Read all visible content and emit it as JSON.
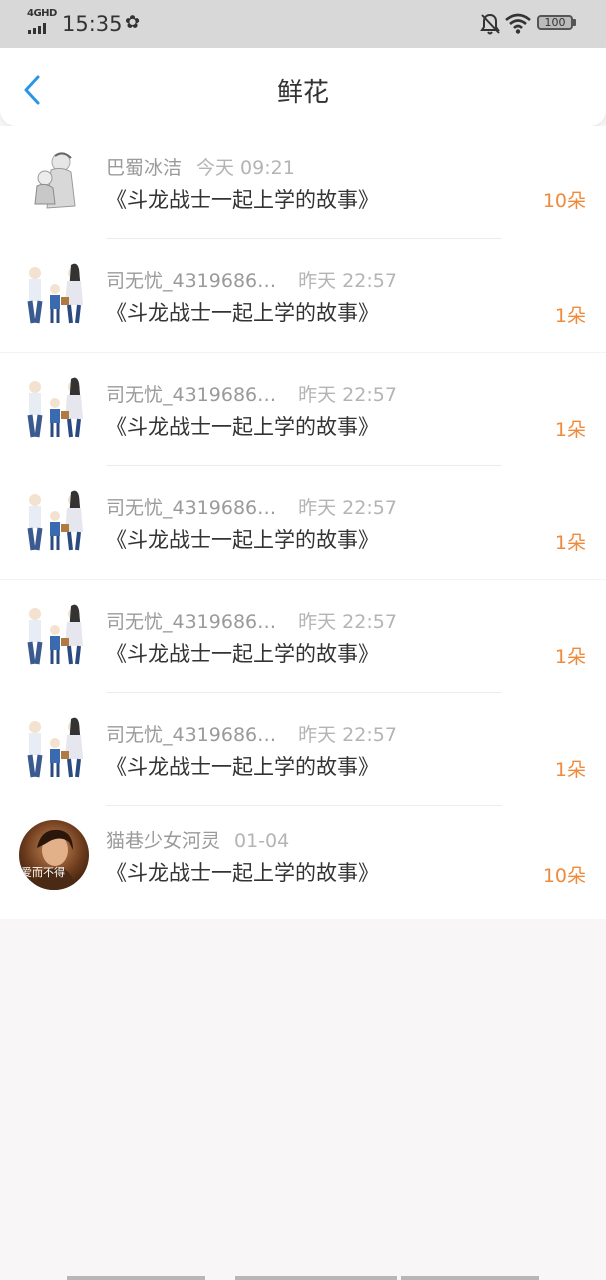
{
  "status_bar": {
    "network": "4GHD",
    "time": "15:35",
    "app_icon": "✿",
    "battery": "100"
  },
  "nav": {
    "title": "鲜花"
  },
  "items": [
    {
      "name": "巴蜀冰洁",
      "time": "今天 09:21",
      "book": "《斗龙战士一起上学的故事》",
      "count": "10朵",
      "avatar": "sketch-mother-child-avatar"
    },
    {
      "name": "司无忧_4319686…",
      "time": "昨天 22:57",
      "book": "《斗龙战士一起上学的故事》",
      "count": "1朵",
      "avatar": "family-illustration-avatar"
    },
    {
      "name": "司无忧_4319686…",
      "time": "昨天 22:57",
      "book": "《斗龙战士一起上学的故事》",
      "count": "1朵",
      "avatar": "family-illustration-avatar"
    },
    {
      "name": "司无忧_4319686…",
      "time": "昨天 22:57",
      "book": "《斗龙战士一起上学的故事》",
      "count": "1朵",
      "avatar": "family-illustration-avatar"
    },
    {
      "name": "司无忧_4319686…",
      "time": "昨天 22:57",
      "book": "《斗龙战士一起上学的故事》",
      "count": "1朵",
      "avatar": "family-illustration-avatar"
    },
    {
      "name": "司无忧_4319686…",
      "time": "昨天 22:57",
      "book": "《斗龙战士一起上学的故事》",
      "count": "1朵",
      "avatar": "family-illustration-avatar"
    },
    {
      "name": "猫巷少女河灵",
      "time": "01-04",
      "book": "《斗龙战士一起上学的故事》",
      "count": "10朵",
      "avatar": "photo-avatar",
      "avatar_caption": "爱而不得"
    }
  ],
  "colors": {
    "accent_back": "#2a96e8",
    "count": "#f08a3a",
    "name": "#9a9a9a",
    "title": "#333333"
  }
}
